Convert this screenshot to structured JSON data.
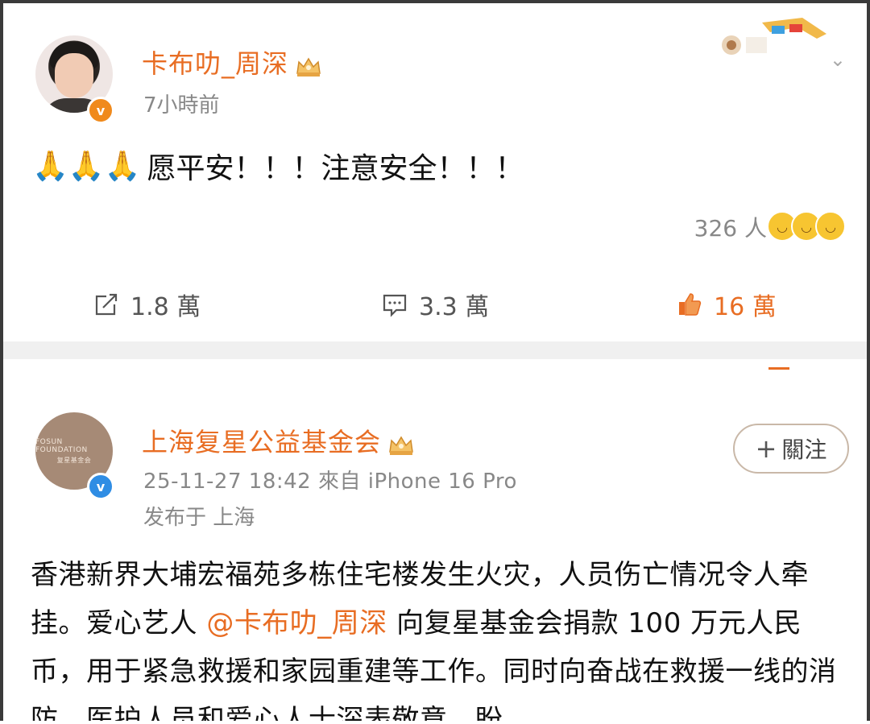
{
  "post1": {
    "author": "卡布叻_周深",
    "time": "7小時前",
    "content_emoji": "🙏🙏🙏",
    "content_text": "愿平安！！！注意安全！！！",
    "reactions_count": "326 人",
    "actions": {
      "share": "1.8 萬",
      "comment": "3.3 萬",
      "like": "16 萬"
    }
  },
  "post2": {
    "author": "上海复星公益基金会",
    "avatar_text_1": "FOSUN FOUNDATION",
    "avatar_text_2": "复星基金会",
    "follow_label": "關注",
    "meta": "25-11-27 18:42  來自 iPhone 16 Pro",
    "location": "发布于 上海",
    "content_part1": "香港新界大埔宏福苑多栋住宅楼发生火灾，人员伤亡情况令人牵挂。爱心艺人 ",
    "mention": "@卡布叻_周深",
    "content_part2": " 向复星基金会捐款 100 万元人民币，用于紧急救援和家园重建等工作。同时向奋战在救援一线的消防、医护人员和爱心人士深表敬意。盼"
  },
  "colors": {
    "accent": "#e86d23",
    "verified_orange": "#f08a1c",
    "verified_blue": "#2f8de4",
    "muted": "#888888"
  },
  "icons": [
    "share-icon",
    "comment-icon",
    "thumbs-up-icon",
    "crown-icon",
    "chevron-down-icon",
    "verified-icon",
    "plus-icon"
  ]
}
